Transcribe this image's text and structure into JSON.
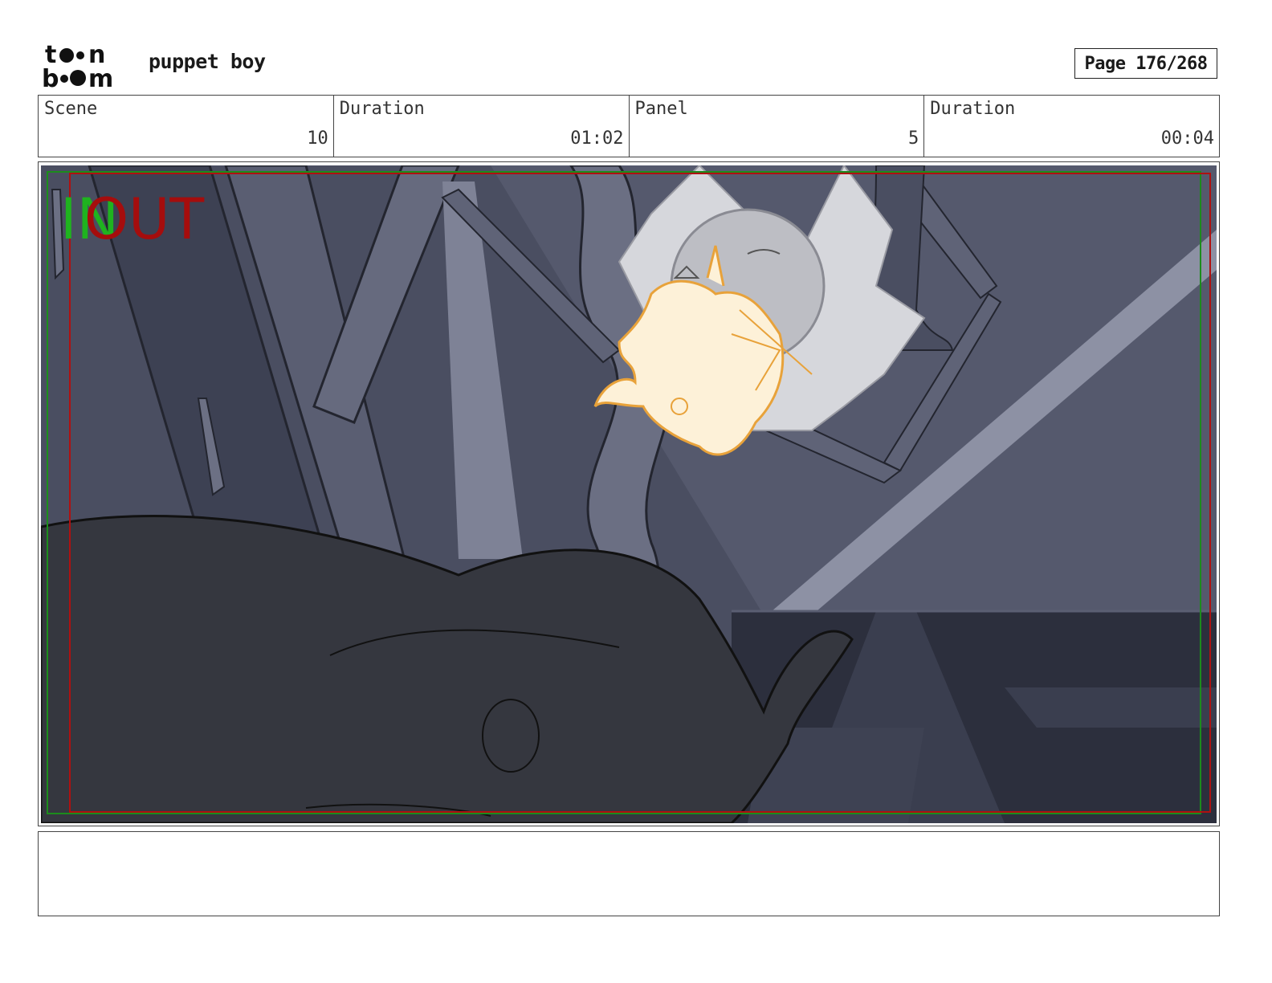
{
  "header": {
    "logo_text": "toon boom",
    "project_title": "puppet boy",
    "page_label": "Page 176/268"
  },
  "info": {
    "scene_label": "Scene",
    "scene_value": "10",
    "scene_duration_label": "Duration",
    "scene_duration_value": "01:02",
    "panel_label": "Panel",
    "panel_value": "5",
    "panel_duration_label": "Duration",
    "panel_duration_value": "00:04"
  },
  "panel": {
    "in_mark": "IN",
    "out_mark": "OUT"
  },
  "notes": {
    "text": ""
  },
  "colors": {
    "in_mark": "#1fb31f",
    "out_mark": "#a50d0d",
    "safe_frame_red": "#b01010",
    "safe_frame_green": "#1c8c1c",
    "character_sketch": "#e8a23a"
  }
}
